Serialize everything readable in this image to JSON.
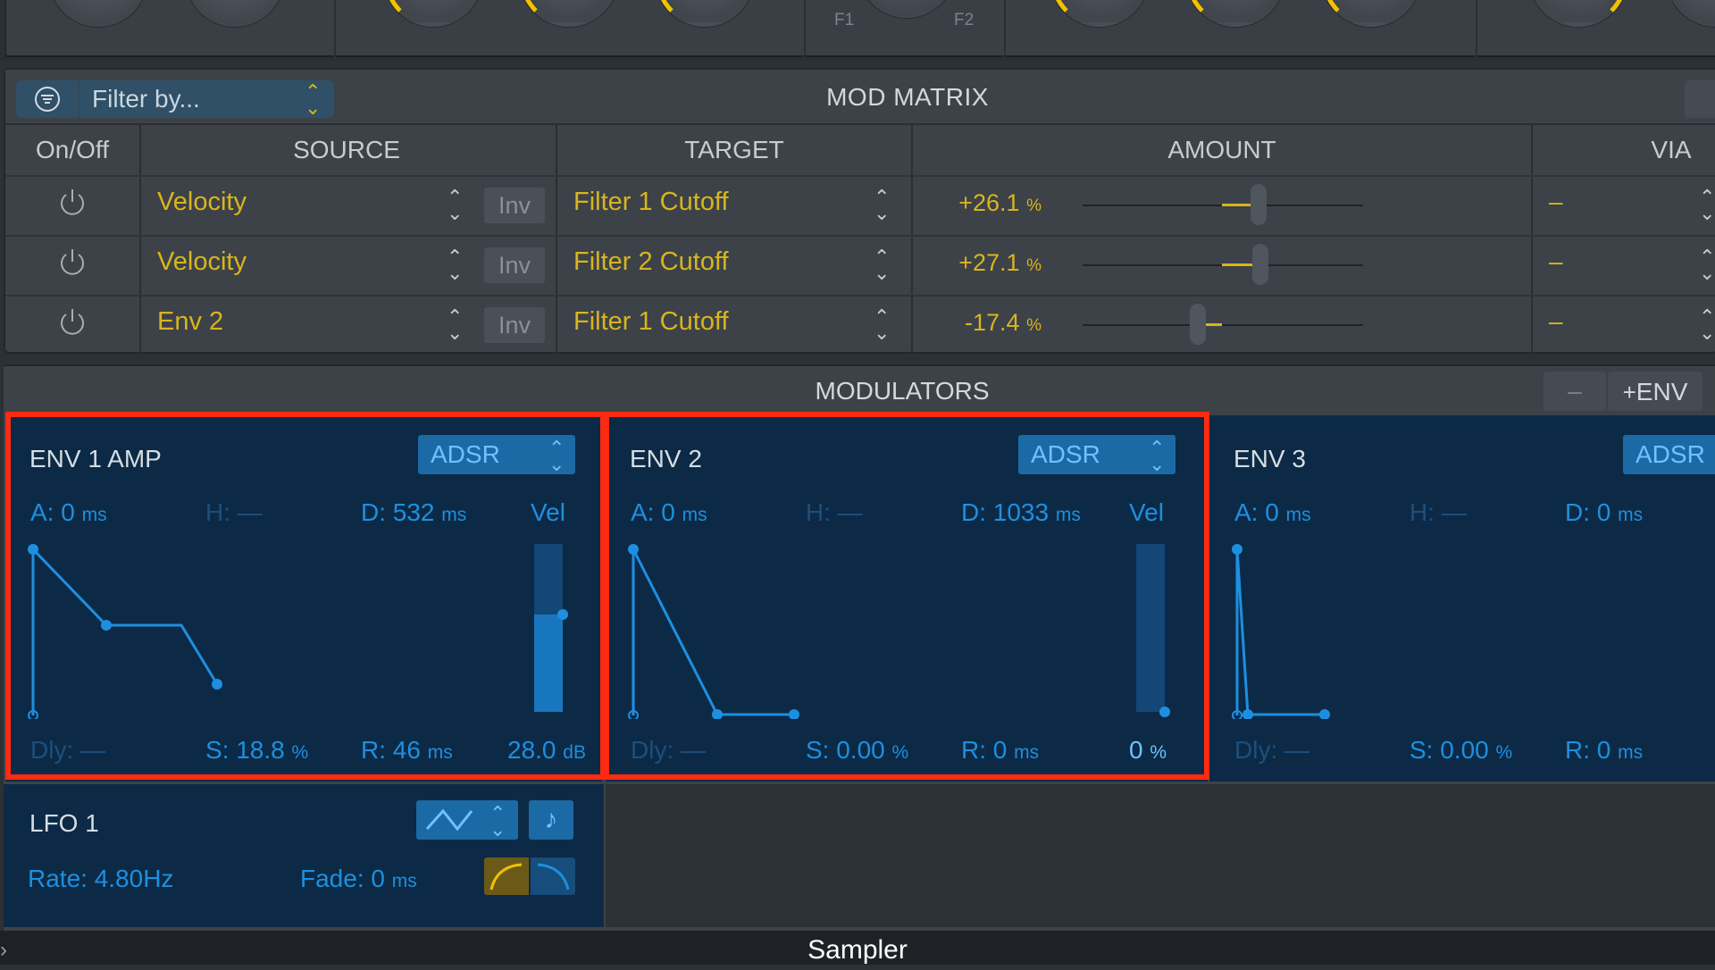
{
  "top": {
    "f1_label": "F1",
    "f2_label": "F2"
  },
  "mod_matrix": {
    "title": "MOD MATRIX",
    "filter_placeholder": "Filter by...",
    "columns": {
      "onoff": "On/Off",
      "source": "SOURCE",
      "target": "TARGET",
      "amount": "AMOUNT",
      "via": "VIA"
    },
    "rows": [
      {
        "source": "Velocity",
        "inv": "Inv",
        "target": "Filter 1 Cutoff",
        "amount": "+26.1",
        "amount_unit": "%",
        "amount_value": 26.1,
        "via": "–"
      },
      {
        "source": "Velocity",
        "inv": "Inv",
        "target": "Filter 2 Cutoff",
        "amount": "+27.1",
        "amount_unit": "%",
        "amount_value": 27.1,
        "via": "–"
      },
      {
        "source": "Env 2",
        "inv": "Inv",
        "target": "Filter 1 Cutoff",
        "amount": "-17.4",
        "amount_unit": "%",
        "amount_value": -17.4,
        "via": "–"
      }
    ]
  },
  "modulators": {
    "title": "MODULATORS",
    "minus_label": "–",
    "add_env_label": "ENV",
    "envs": [
      {
        "title": "ENV 1 AMP",
        "mode": "ADSR",
        "a": "A: 0",
        "a_unit": "ms",
        "h": "H: —",
        "d": "D: 532",
        "d_unit": "ms",
        "vel": "Vel",
        "dly": "Dly: —",
        "s": "S: 18.8",
        "s_unit": "%",
        "r": "R: 46",
        "r_unit": "ms",
        "vel_value": "28.0",
        "vel_unit": "dB",
        "vel_level": 0.58
      },
      {
        "title": "ENV 2",
        "mode": "ADSR",
        "a": "A: 0",
        "a_unit": "ms",
        "h": "H: —",
        "d": "D: 1033",
        "d_unit": "ms",
        "vel": "Vel",
        "dly": "Dly: —",
        "s": "S: 0.00",
        "s_unit": "%",
        "r": "R: 0",
        "r_unit": "ms",
        "vel_value": "0",
        "vel_unit": "%",
        "vel_level": 0.0
      },
      {
        "title": "ENV 3",
        "mode": "ADSR",
        "a": "A: 0",
        "a_unit": "ms",
        "h": "H: —",
        "d": "D: 0",
        "d_unit": "ms",
        "dly": "Dly: —",
        "s": "S: 0.00",
        "s_unit": "%",
        "r": "R: 0",
        "r_unit": "ms"
      }
    ],
    "lfo": {
      "title": "LFO 1",
      "rate": "Rate: 4.80Hz",
      "fade": "Fade: 0",
      "fade_unit": "ms"
    }
  },
  "bottom": {
    "title": "Sampler"
  },
  "colors": {
    "accent_yellow": "#d9b51c",
    "env_blue": "#1e8fe0",
    "highlight_red": "#ff2a12"
  }
}
